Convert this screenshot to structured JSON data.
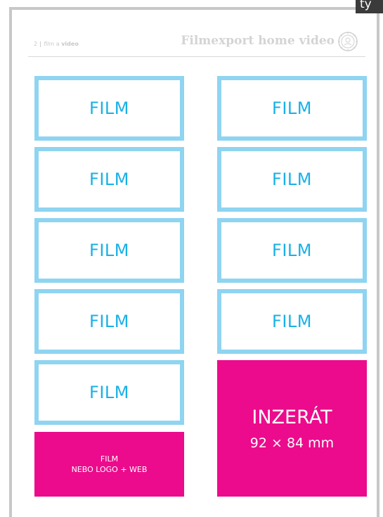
{
  "corner_tab": {
    "text": "ty"
  },
  "header": {
    "page_number": "2",
    "separator": "|",
    "section_italic": "film",
    "section_connector": "a",
    "section_bold": "video",
    "brand_title": "Filmexport home video"
  },
  "film_boxes": [
    {
      "label": "FILM"
    },
    {
      "label": "FILM"
    },
    {
      "label": "FILM"
    },
    {
      "label": "FILM"
    },
    {
      "label": "FILM"
    },
    {
      "label": "FILM"
    },
    {
      "label": "FILM"
    },
    {
      "label": "FILM"
    },
    {
      "label": "FILM"
    }
  ],
  "ad_small": {
    "line1": "FILM",
    "line2": "NEBO LOGO + WEB"
  },
  "ad_big": {
    "line1": "INZERÁT",
    "line2": "92 × 84 mm"
  },
  "colors": {
    "box_border": "#8fd4f1",
    "box_text": "#1ab0e5",
    "ad_background": "#ec0b8c",
    "frame": "#c8c8c8"
  }
}
